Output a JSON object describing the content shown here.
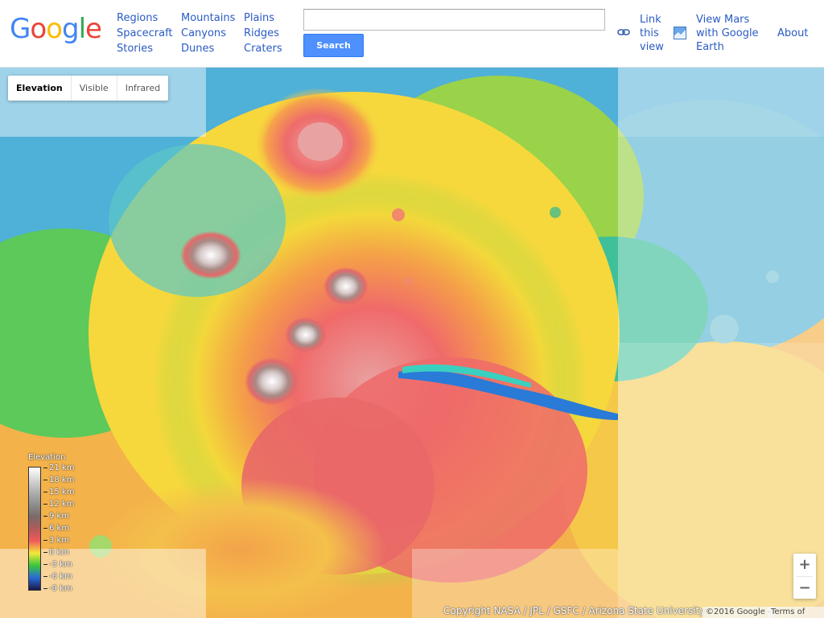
{
  "logo": "Google",
  "nav": {
    "col1": [
      "Regions",
      "Spacecraft",
      "Stories"
    ],
    "col2": [
      "Mountains",
      "Canyons",
      "Dunes"
    ],
    "col3": [
      "Plains",
      "Ridges",
      "Craters"
    ]
  },
  "search": {
    "value": "",
    "button_label": "Search"
  },
  "links": {
    "link_view": [
      "Link",
      "this",
      "view"
    ],
    "google_earth": [
      "View Mars",
      "with Google",
      "Earth"
    ],
    "about": "About"
  },
  "map_types": {
    "options": [
      "Elevation",
      "Visible",
      "Infrared"
    ],
    "selected": "Elevation"
  },
  "legend": {
    "title": "Elevation",
    "labels": [
      "21 km",
      "18 km",
      "15 km",
      "12 km",
      "9 km",
      "6 km",
      "3 km",
      "0 km",
      "-3 km",
      "-6 km",
      "-9 km"
    ],
    "colors": [
      "#ffffff",
      "#d6d6d6",
      "#b0b0b0",
      "#8f8f8f",
      "#7a6a6a",
      "#b25a5a",
      "#f05a5a",
      "#f5e83a",
      "#3ac83a",
      "#2a6ad6",
      "#1a1a4a"
    ]
  },
  "zoom": {
    "in": "+",
    "out": "−"
  },
  "attribution": {
    "copyright": "Copyright NASA / JPL / GSFC / Arizona State University",
    "google": "©2016 Google -",
    "terms": "Terms of Use"
  },
  "icons": {
    "link": "link-chain-icon",
    "earth": "google-earth-icon"
  }
}
